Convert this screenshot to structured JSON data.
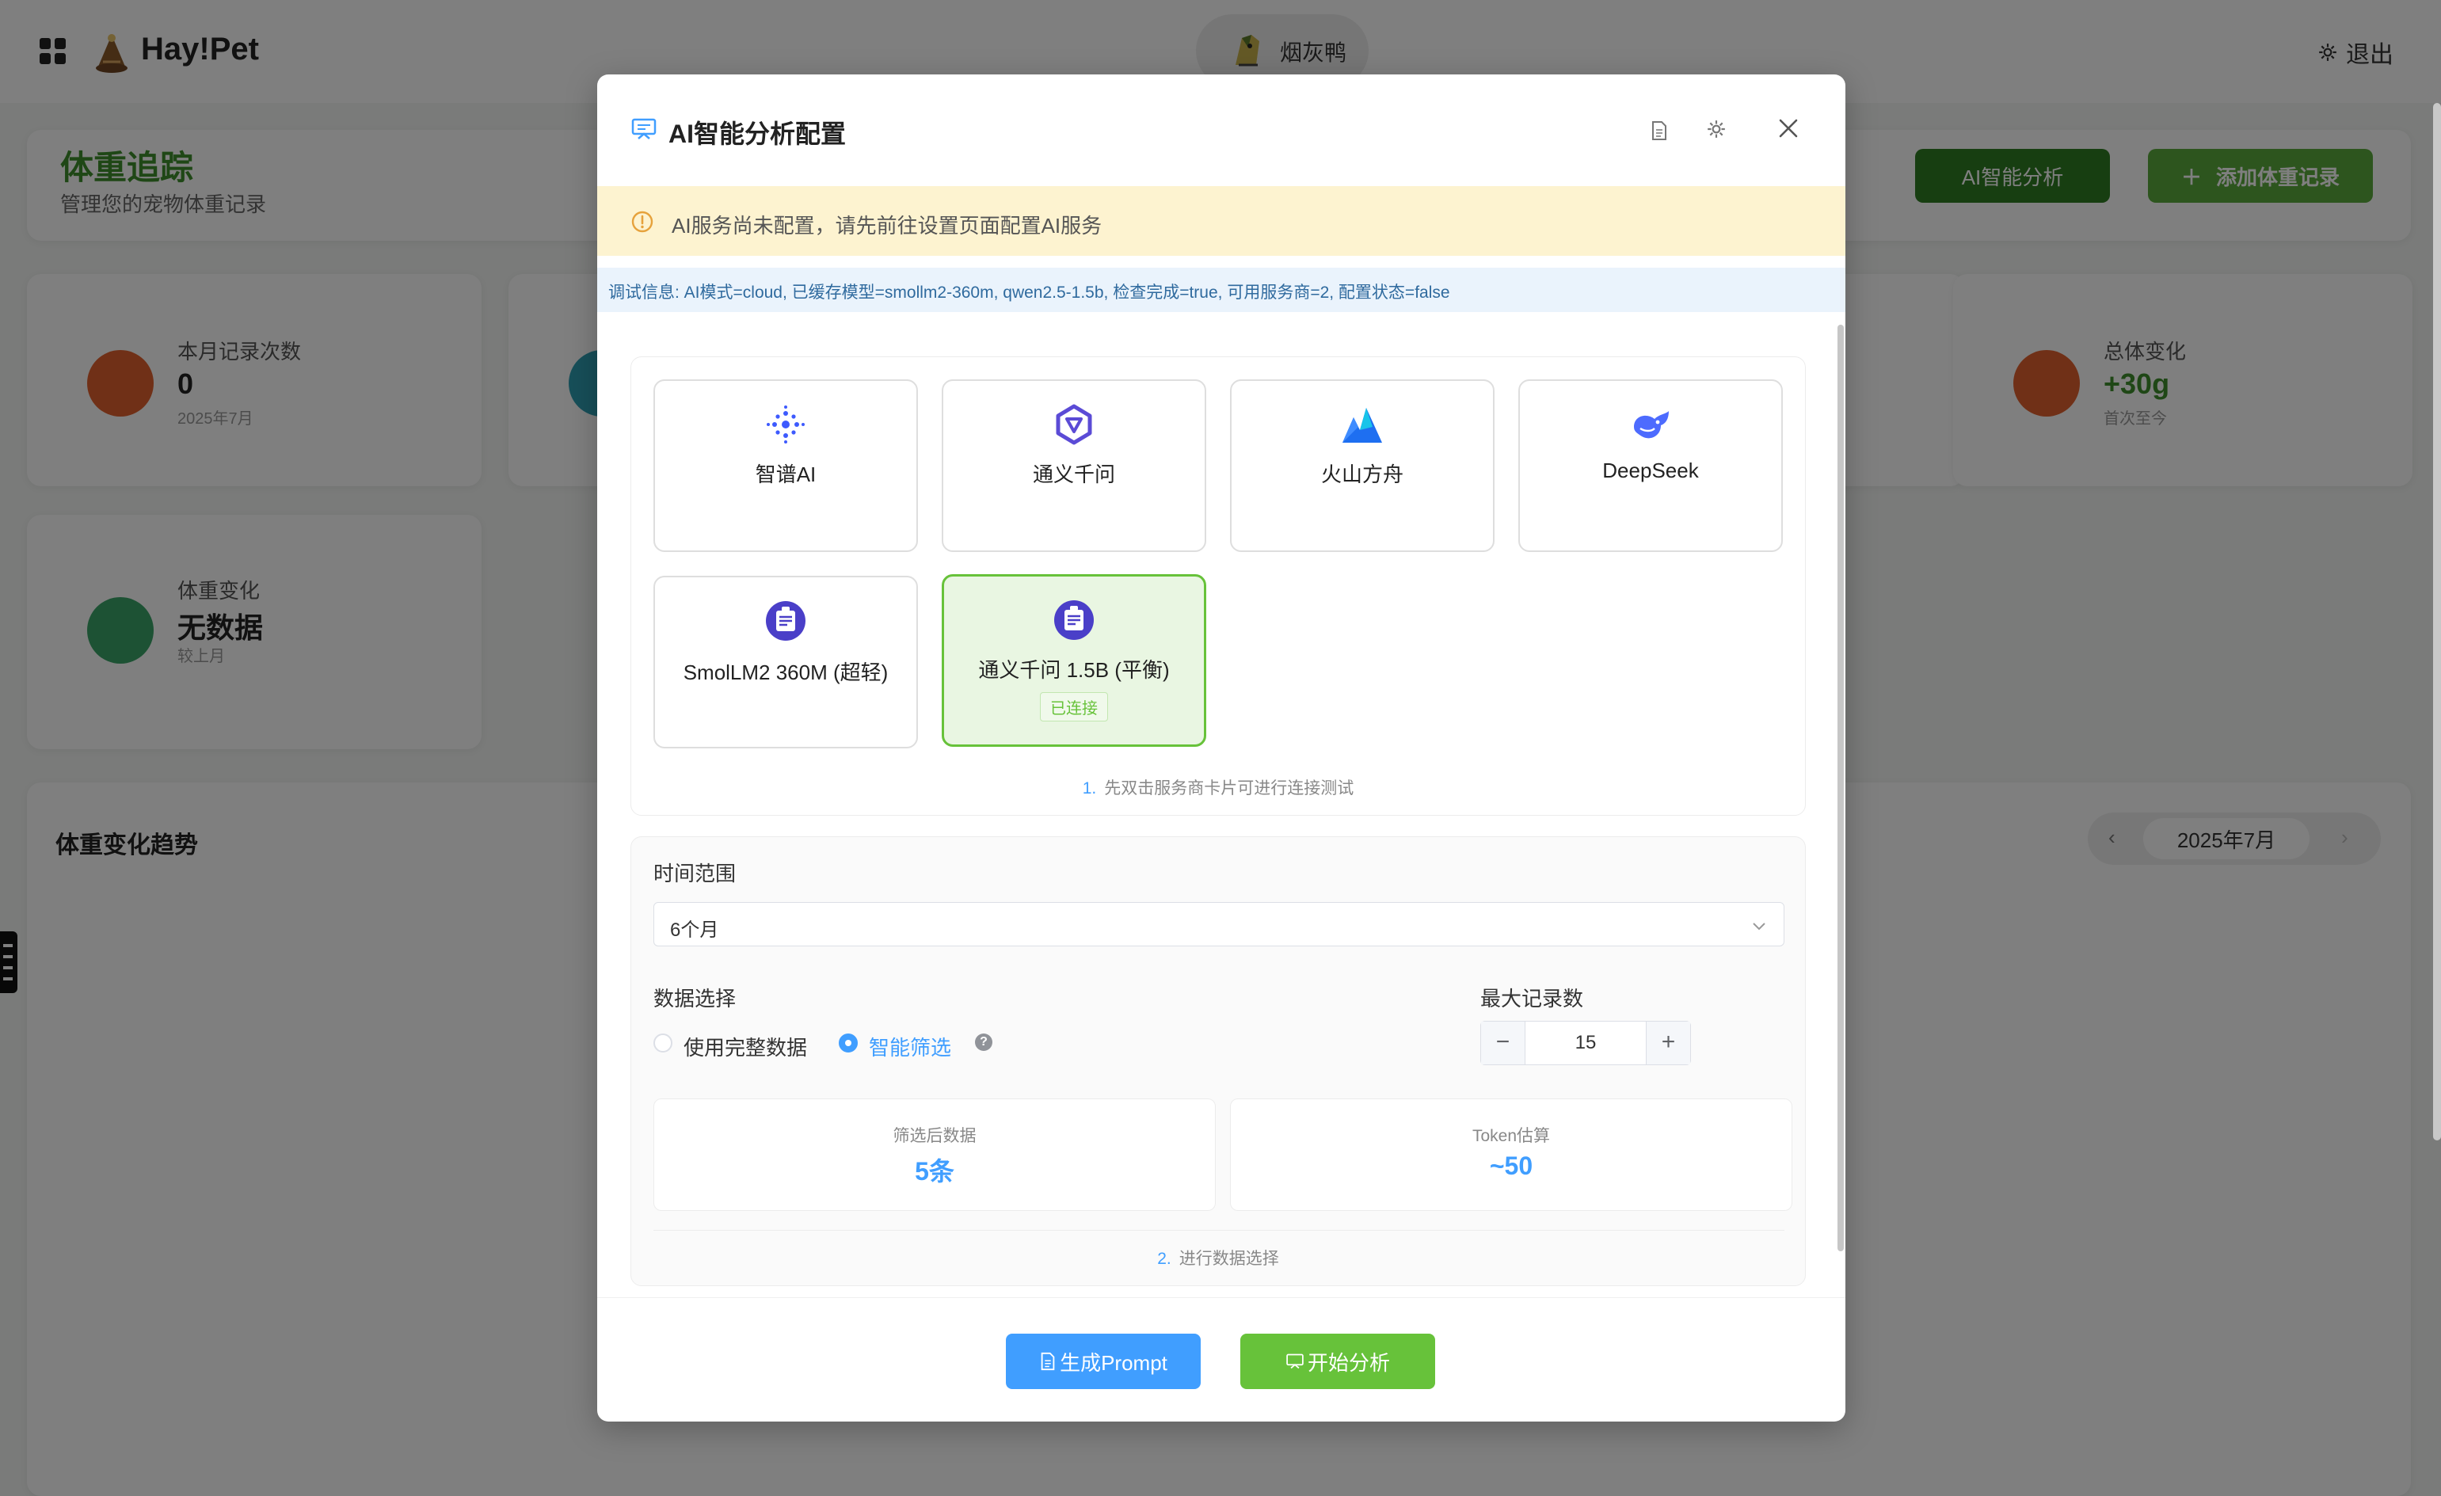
{
  "app": {
    "logo_text": "Hay!Pet",
    "pet_name": "烟灰鸭",
    "logout_label": "退出"
  },
  "page": {
    "title": "体重追踪",
    "subtitle": "管理您的宠物体重记录",
    "ai_button": "AI智能分析",
    "add_button": "添加体重记录"
  },
  "stats": [
    {
      "label": "本月记录次数",
      "value": "0",
      "sub": "2025年7月",
      "color": "#e0612e"
    },
    {
      "label": "总体变化",
      "value": "+30g",
      "sub": "首次至今",
      "color": "#e0612e"
    },
    {
      "label": "体重变化",
      "value": "无数据",
      "sub": "较上月",
      "color": "#3aa568"
    }
  ],
  "trend": {
    "title": "体重变化趋势",
    "month": "2025年7月",
    "prev": "‹",
    "next": "›"
  },
  "modal": {
    "title": "AI智能分析配置",
    "warning": "AI服务尚未配置，请先前往设置页面配置AI服务",
    "debug": "调试信息: AI模式=cloud, 已缓存模型=smollm2-360m, qwen2.5-1.5b, 检查完成=true, 可用服务商=2, 配置状态=false",
    "providers": [
      {
        "name": "智谱AI",
        "icon": "zhipu-icon"
      },
      {
        "name": "通义千问",
        "icon": "tongyi-icon"
      },
      {
        "name": "火山方舟",
        "icon": "volcano-icon"
      },
      {
        "name": "DeepSeek",
        "icon": "deepseek-icon"
      },
      {
        "name": "SmolLM2 360M (超轻)",
        "icon": "local-model-icon"
      },
      {
        "name": "通义千问 1.5B (平衡)",
        "icon": "local-model-icon",
        "status": "已连接"
      }
    ],
    "step1_num": "1.",
    "step1_text": "先双击服务商卡片可进行连接测试",
    "time_range_label": "时间范围",
    "time_range_value": "6个月",
    "data_select_label": "数据选择",
    "option_full": "使用完整数据",
    "option_smart": "智能筛选",
    "help_glyph": "?",
    "max_records_label": "最大记录数",
    "max_records_value": "15",
    "stepper_minus": "−",
    "stepper_plus": "+",
    "filtered_label": "筛选后数据",
    "filtered_value": "5条",
    "token_label": "Token估算",
    "token_value": "~50",
    "step2_num": "2.",
    "step2_text": "进行数据选择",
    "btn_prompt": "生成Prompt",
    "btn_analyze": "开始分析"
  },
  "colors": {
    "primary": "#409eff",
    "success": "#67c23a",
    "brand_green": "#3f8f2c",
    "warning_bg": "#fdf3d0"
  }
}
